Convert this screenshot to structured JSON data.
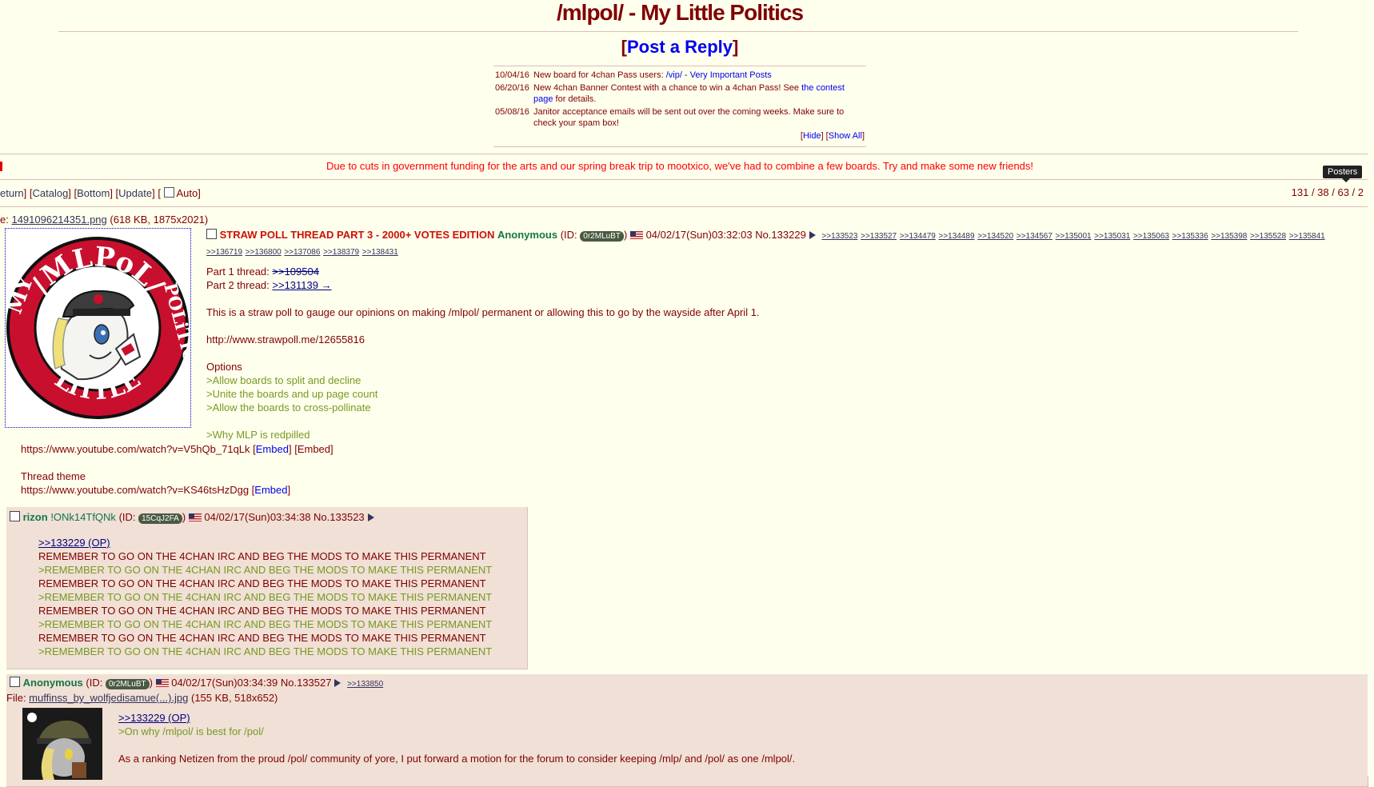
{
  "board": {
    "title": "/mlpol/ - My Little Politics",
    "post_reply": "Post a Reply"
  },
  "news": [
    {
      "date": "10/04/16",
      "text": "New board for 4chan Pass users: ",
      "link": "/vip/ - Very Important Posts",
      "after": ""
    },
    {
      "date": "06/20/16",
      "text": "New 4chan Banner Contest with a chance to win a 4chan Pass! See ",
      "link": "the contest page",
      "after": " for details."
    },
    {
      "date": "05/08/16",
      "text": "Janitor acceptance emails will be sent out over the coming weeks. Make sure to check your spam box!",
      "link": "",
      "after": ""
    }
  ],
  "news_controls": {
    "hide": "Hide",
    "show_all": "Show All"
  },
  "announcement": "Due to cuts in government funding for the arts and our spring break trip to mootxico, we've had to combine a few boards. Try and make some new friends!",
  "nav": {
    "return": "eturn",
    "catalog": "Catalog",
    "bottom": "Bottom",
    "update": "Update",
    "auto": "Auto"
  },
  "tooltip": "Posters",
  "counts": "131 / 38 / 63 / 2",
  "op": {
    "file_prefix": "e: ",
    "file_name": "1491096214351.png",
    "file_meta": "(618 KB, 1875x2021)",
    "subject": "STRAW POLL THREAD PART 3 - 2000+ VOTES EDITION",
    "name": "Anonymous",
    "id": "0r2MLuBT",
    "datetime": "04/02/17(Sun)03:32:03",
    "no": "No.133229",
    "backlinks": [
      ">>133523",
      ">>133527",
      ">>134479",
      ">>134489",
      ">>134520",
      ">>134567",
      ">>135001",
      ">>135031",
      ">>135063",
      ">>135336",
      ">>135398",
      ">>135528",
      ">>135841",
      ">>136719",
      ">>136800",
      ">>137086",
      ">>138379",
      ">>138431"
    ],
    "part1_label": "Part 1 thread: ",
    "part1_link": ">>109504",
    "part2_label": "Part 2 thread: ",
    "part2_link": ">>131139 →",
    "line1": "This is a straw poll to gauge our opinions on making /mlpol/ permanent or allowing this to go by the wayside after April 1.",
    "url": "http://www.strawpoll.me/12655816",
    "options_title": "Options",
    "options": [
      ">Allow boards to split and decline",
      ">Unite the boards and up page count",
      ">Allow the boards to cross-pollinate"
    ],
    "redpill": ">Why MLP is redpilled",
    "yt1": "https://www.youtube.com/watch?v=V5hQb_71qLk",
    "embed": "Embed",
    "theme_label": "Thread theme",
    "yt2": "https://www.youtube.com/watch?v=KS46tsHzDgg",
    "logo_top": "/MLPoL/",
    "logo_left": "MY",
    "logo_bottom": "LiTTLE",
    "logo_right": "POLiTiCS"
  },
  "reply1": {
    "name": "rizon",
    "trip": "!ONk14TfQNk",
    "id": "15CqJ2FA",
    "datetime": "04/02/17(Sun)03:34:38",
    "no": "No.133523",
    "quote": ">>133229 (OP)",
    "lines": [
      "REMEMBER TO GO ON THE 4CHAN IRC AND BEG THE MODS TO MAKE THIS PERMANENT",
      ">REMEMBER TO GO ON THE 4CHAN IRC AND BEG THE MODS TO MAKE THIS PERMANENT",
      "REMEMBER TO GO ON THE 4CHAN IRC AND BEG THE MODS TO MAKE THIS PERMANENT",
      ">REMEMBER TO GO ON THE 4CHAN IRC AND BEG THE MODS TO MAKE THIS PERMANENT",
      "REMEMBER TO GO ON THE 4CHAN IRC AND BEG THE MODS TO MAKE THIS PERMANENT",
      ">REMEMBER TO GO ON THE 4CHAN IRC AND BEG THE MODS TO MAKE THIS PERMANENT",
      "REMEMBER TO GO ON THE 4CHAN IRC AND BEG THE MODS TO MAKE THIS PERMANENT",
      ">REMEMBER TO GO ON THE 4CHAN IRC AND BEG THE MODS TO MAKE THIS PERMANENT"
    ]
  },
  "reply2": {
    "name": "Anonymous",
    "id": "0r2MLuBT",
    "datetime": "04/02/17(Sun)03:34:39",
    "no": "No.133527",
    "backlink": ">>133850",
    "file_label": "File: ",
    "file_name": "muffinss_by_wolfjedisamue(...).jpg",
    "file_meta": "(155 KB, 518x652)",
    "quote": ">>133229 (OP)",
    "green": ">On why /mlpol/ is best for /pol/",
    "text": "As a ranking Netizen from the proud /pol/ community of yore, I put forward a motion for the forum to consider keeping /mlp/ and /pol/ as one /mlpol/."
  }
}
